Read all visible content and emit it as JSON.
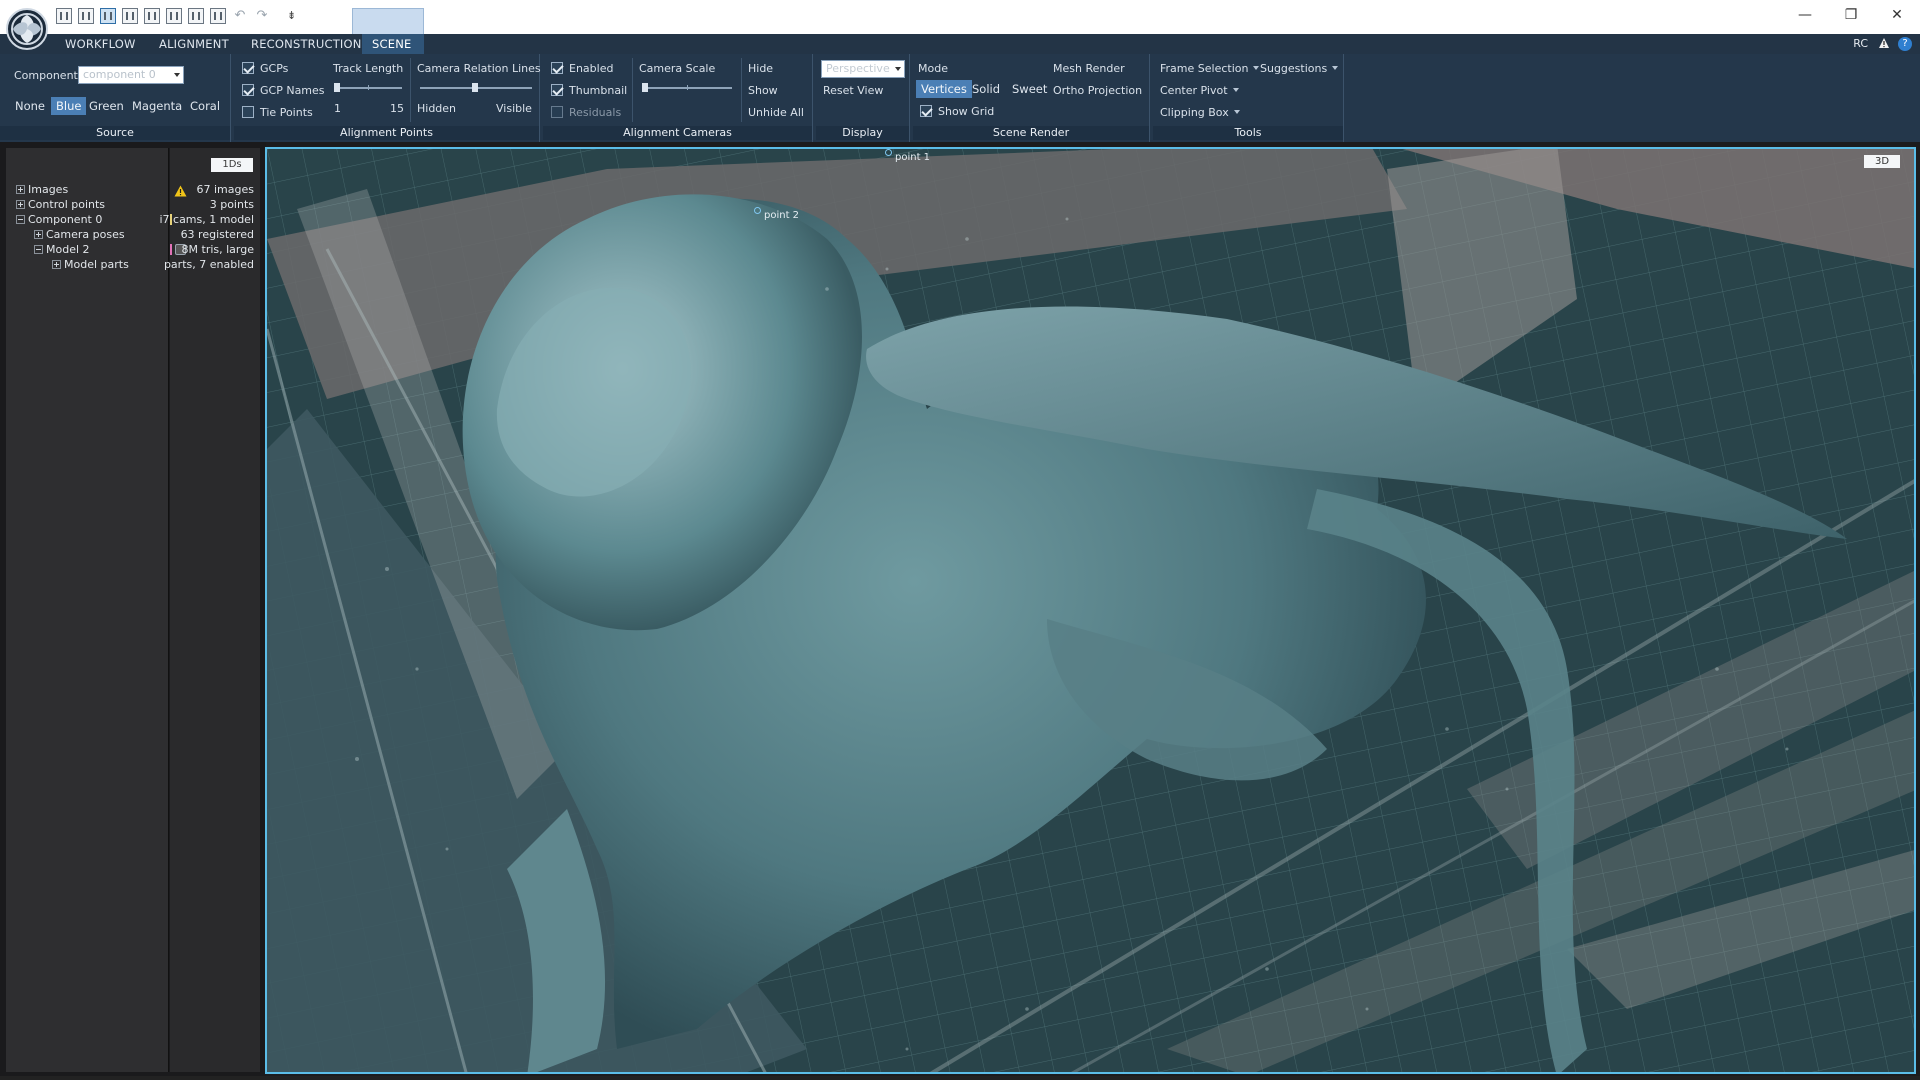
{
  "app": {
    "menu_tabs": [
      "WORKFLOW",
      "ALIGNMENT",
      "RECONSTRUCTION",
      "SCENE"
    ],
    "active_tab": "SCENE",
    "rc_label": "RC",
    "help_glyph": "?"
  },
  "window_controls": {
    "minimize": "—",
    "restore": "❐",
    "close": "✕"
  },
  "qat": {
    "more": "⇟",
    "undo": "↶",
    "redo": "↷"
  },
  "ribbon": {
    "source": {
      "title": "Source",
      "component_label": "Component",
      "component_value": "component 0",
      "colors": [
        "None",
        "Blue",
        "Green",
        "Magenta",
        "Coral"
      ],
      "selected_color": "Blue"
    },
    "alignment_points": {
      "title": "Alignment Points",
      "gcps": "GCPs",
      "gcp_names": "GCP Names",
      "tie_points": "Tie Points",
      "track_length_label": "Track Length",
      "track_min": "1",
      "track_max": "15",
      "camera_relation_label": "Camera Relation Lines",
      "hidden_label": "Hidden",
      "visible_label": "Visible"
    },
    "alignment_cameras": {
      "title": "Alignment Cameras",
      "enabled": "Enabled",
      "thumbnail": "Thumbnail",
      "residuals": "Residuals",
      "camera_scale": "Camera Scale",
      "hide": "Hide",
      "show": "Show",
      "unhide_all": "Unhide All"
    },
    "display": {
      "title": "Display",
      "projection_value": "Perspective",
      "reset_view": "Reset View"
    },
    "scene_render": {
      "title": "Scene Render",
      "mode_label": "Mode",
      "mesh_render_label": "Mesh Render",
      "modes": [
        "Vertices",
        "Solid",
        "Sweet"
      ],
      "selected_mode": "Vertices",
      "ortho_projection": "Ortho Projection",
      "show_grid": "Show Grid"
    },
    "tools": {
      "title": "Tools",
      "frame_selection": "Frame Selection",
      "suggestions": "Suggestions",
      "center_pivot": "Center Pivot",
      "clipping_box": "Clipping Box"
    }
  },
  "tree": {
    "info_button": "1Ds",
    "items": [
      {
        "label": "Images",
        "info": "67 images"
      },
      {
        "label": "Control points",
        "info": "3 points"
      },
      {
        "label": "Component 0",
        "info": "i7 cams, 1 model"
      },
      {
        "label": "Camera poses",
        "info": "63 registered"
      },
      {
        "label": "Model 2",
        "info": "8M tris, large"
      },
      {
        "label": "Model parts",
        "info": "parts, 7 enabled"
      }
    ]
  },
  "viewport": {
    "view_mode": "3D",
    "points": [
      "point 1",
      "point 2"
    ]
  },
  "colors": {
    "ribbon_bg": "#24374b",
    "menubar_bg": "#233446",
    "accent": "#5bbde8",
    "selected": "#4b7fb5",
    "floor": "#29444a",
    "statue": "#4f7880"
  }
}
